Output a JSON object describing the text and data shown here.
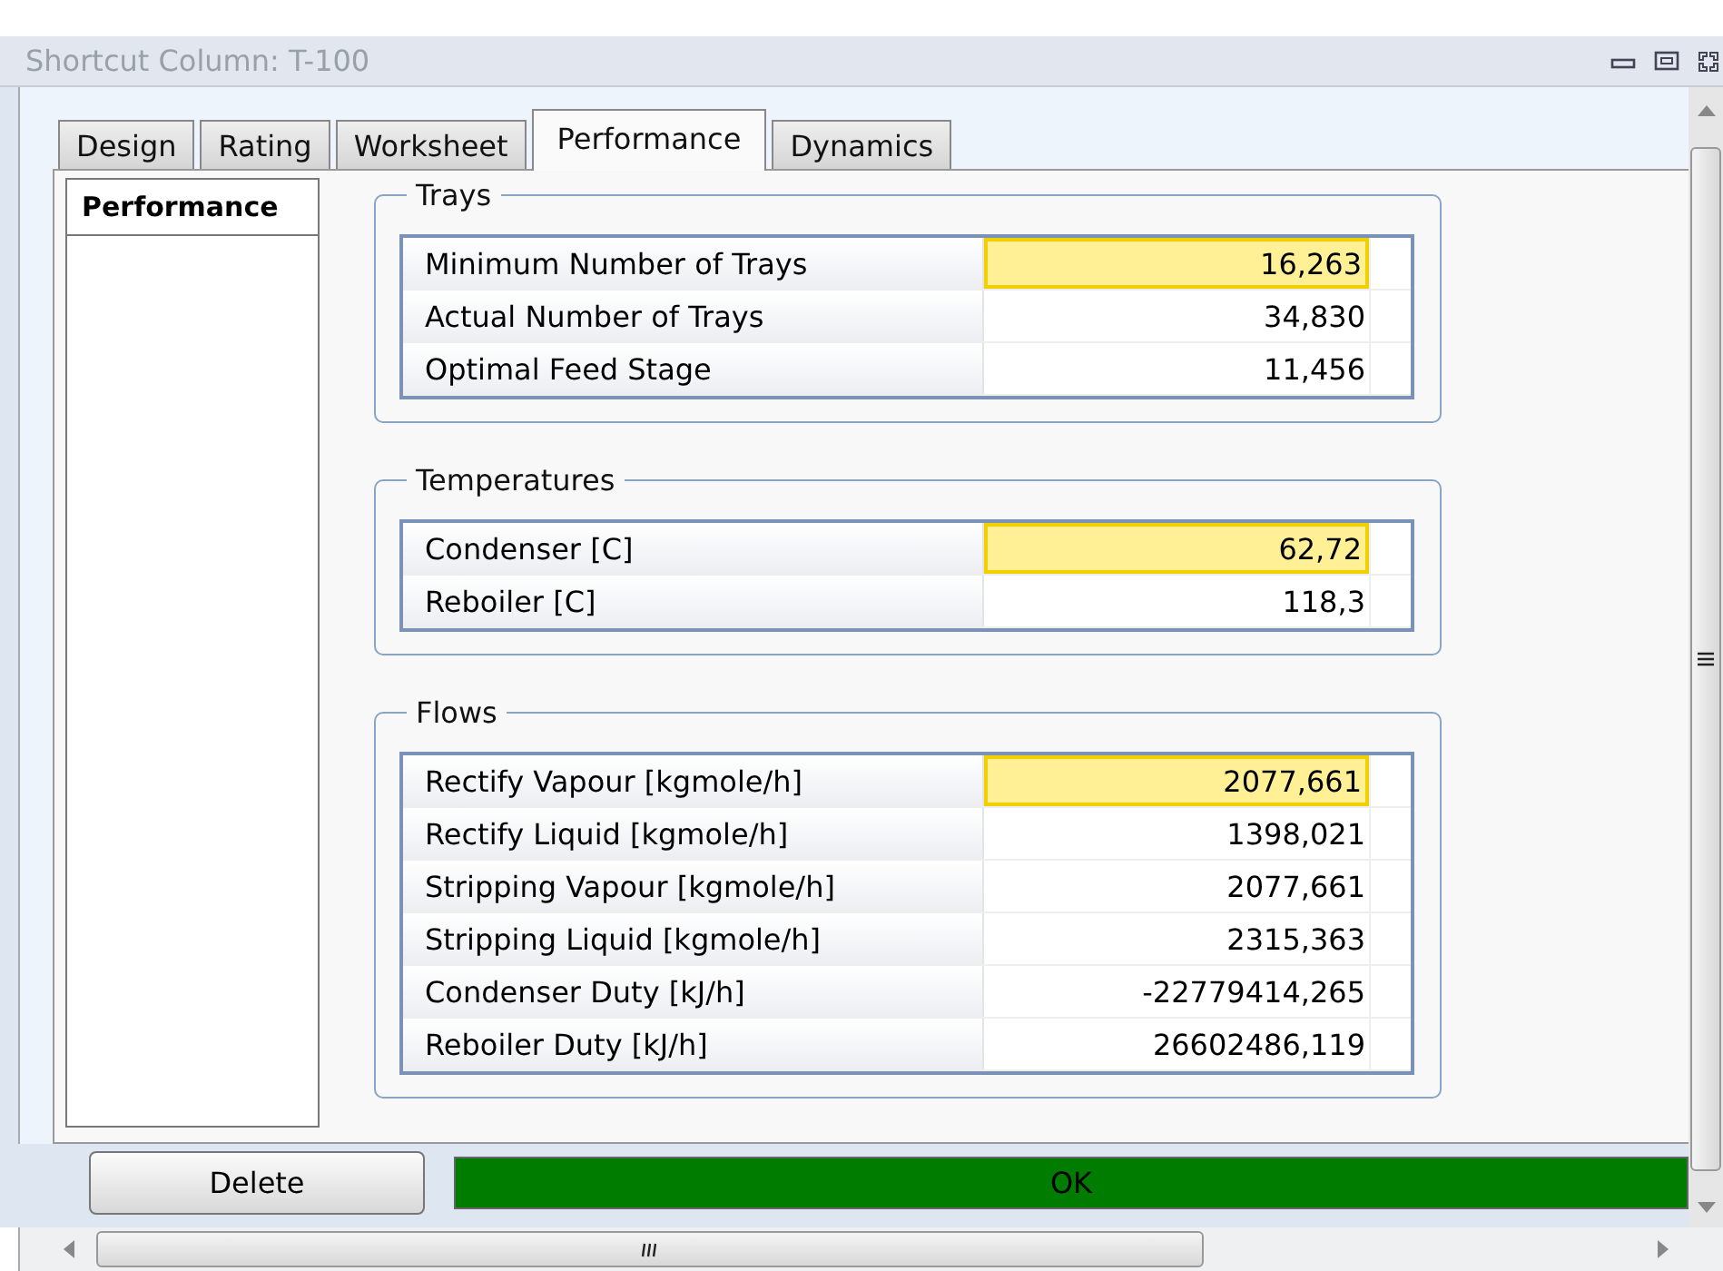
{
  "window": {
    "title": "Shortcut Column: T-100"
  },
  "tabs": [
    {
      "label": "Design",
      "selected": false
    },
    {
      "label": "Rating",
      "selected": false
    },
    {
      "label": "Worksheet",
      "selected": false
    },
    {
      "label": "Performance",
      "selected": true
    },
    {
      "label": "Dynamics",
      "selected": false
    }
  ],
  "sidebar": {
    "items": [
      {
        "label": "Performance",
        "selected": true
      }
    ]
  },
  "groups": [
    {
      "title": "Trays",
      "rows": [
        {
          "label": "Minimum Number of Trays",
          "value": "16,263",
          "highlighted": true
        },
        {
          "label": "Actual Number of Trays",
          "value": "34,830",
          "highlighted": false
        },
        {
          "label": "Optimal Feed Stage",
          "value": "11,456",
          "highlighted": false
        }
      ]
    },
    {
      "title": "Temperatures",
      "rows": [
        {
          "label": "Condenser [C]",
          "value": "62,72",
          "highlighted": true
        },
        {
          "label": "Reboiler [C]",
          "value": "118,3",
          "highlighted": false
        }
      ]
    },
    {
      "title": "Flows",
      "rows": [
        {
          "label": "Rectify Vapour [kgmole/h]",
          "value": "2077,661",
          "highlighted": true
        },
        {
          "label": "Rectify Liquid [kgmole/h]",
          "value": "1398,021",
          "highlighted": false
        },
        {
          "label": "Stripping Vapour [kgmole/h]",
          "value": "2077,661",
          "highlighted": false
        },
        {
          "label": "Stripping Liquid [kgmole/h]",
          "value": "2315,363",
          "highlighted": false
        },
        {
          "label": "Condenser Duty [kJ/h]",
          "value": "-22779414,265",
          "highlighted": false
        },
        {
          "label": "Reboiler Duty [kJ/h]",
          "value": "26602486,119",
          "highlighted": false
        }
      ]
    }
  ],
  "buttons": {
    "delete": "Delete",
    "ok": "OK"
  }
}
